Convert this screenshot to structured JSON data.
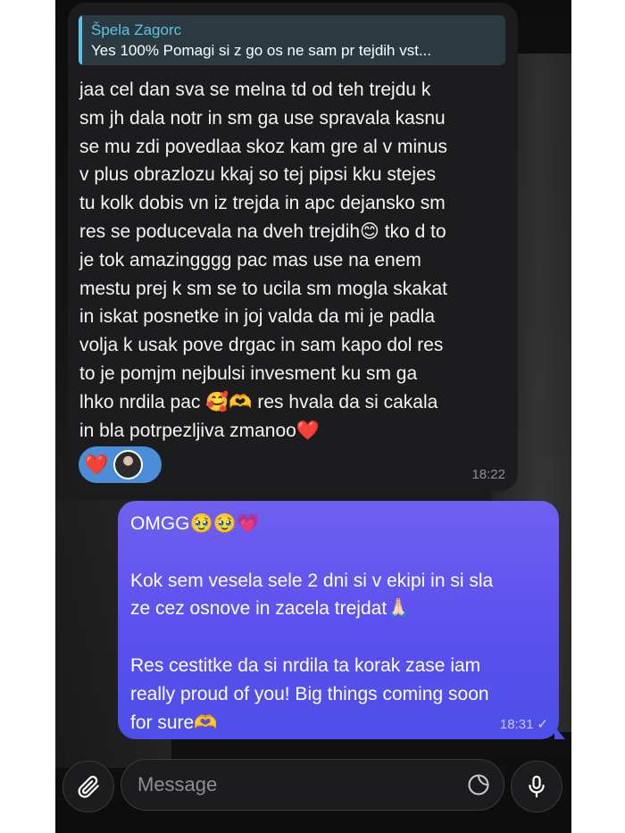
{
  "chat": {
    "incoming": {
      "reply_name": "Špela Zagorc",
      "reply_text": "Yes 100% Pomagi si z go os ne sam pr tejdih vst...",
      "lines": [
        "jaa cel dan sva se melna td od teh trejdu k",
        "sm jh dala notr in sm ga use spravala kasnu",
        "se mu zdi povedlaa skoz kam gre al v minus",
        "v plus obrazlozu kkaj so tej pipsi kku stejes",
        "tu kolk dobis vn iz trejda in apc dejansko sm",
        "res se poducevala na dveh trejdih😊 tko d to",
        "je tok amazingggg pac mas use na enem",
        "mestu prej k sm se to ucila sm mogla skakat",
        "in iskat posnetke in joj valda da mi je padla",
        "volja k usak pove drgac in sam kapo dol res",
        "to je pomjm nejbulsi invesment ku sm ga",
        "lhko nrdila pac 🥰🫶 res hvala da si cakala",
        "in bla potrpezljiva zmanoo❤️"
      ],
      "reaction": "❤️",
      "time": "18:22"
    },
    "outgoing": {
      "lines": [
        "OMGG🥹🥹💗",
        "",
        "Kok sem vesela sele 2 dni si v ekipi in si sla",
        "ze cez osnove in zacela trejdat🙏🏻",
        "",
        "Res cestitke da si nrdila ta korak zase iam",
        "really proud of you! Big things coming soon",
        "for sure🫶"
      ],
      "time": "18:31",
      "status": "✓"
    }
  },
  "composer": {
    "placeholder": "Message",
    "attach_icon": "paperclip-icon",
    "sticker_icon": "sticker-icon",
    "mic_icon": "microphone-icon"
  },
  "colors": {
    "outgoing_bubble": "#5b50ef",
    "incoming_bubble": "#1c1c1e",
    "reply_accent": "#5ec3e4",
    "reaction_pill": "#4a8ed8"
  }
}
